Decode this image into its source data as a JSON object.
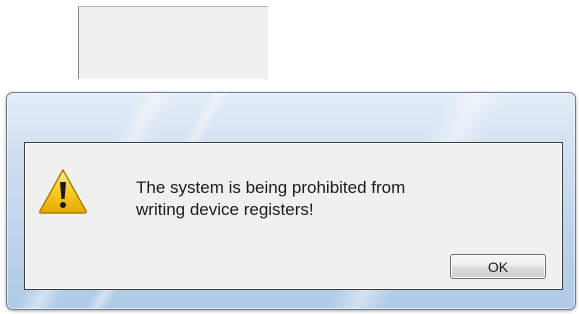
{
  "dialog": {
    "icon": "warning-icon",
    "message_lines": [
      "The system is being prohibited from",
      "writing device registers!"
    ],
    "ok_label": "OK"
  },
  "colors": {
    "frame_accent": "#bcd2ea",
    "client_background": "#f0f0f0",
    "warning_yellow": "#f5c518"
  }
}
